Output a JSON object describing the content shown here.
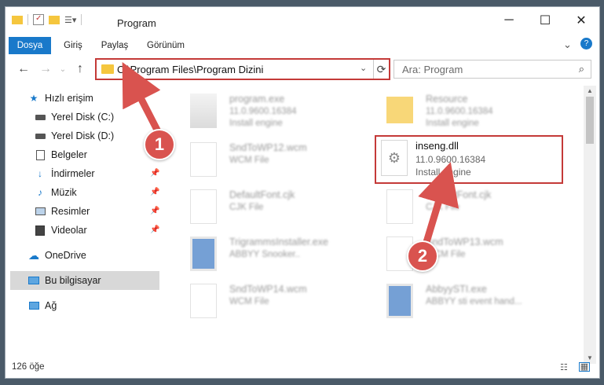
{
  "window": {
    "title": "Program",
    "controls": [
      "minimize",
      "maximize",
      "close"
    ]
  },
  "ribbon": {
    "tabs": [
      {
        "label": "Dosya",
        "active": true
      },
      {
        "label": "Giriş",
        "active": false
      },
      {
        "label": "Paylaş",
        "active": false
      },
      {
        "label": "Görünüm",
        "active": false
      }
    ]
  },
  "address": {
    "path": "C:\\Program Files\\Program Dizini"
  },
  "search": {
    "placeholder": "Ara: Program"
  },
  "sidebar": {
    "items": [
      {
        "label": "Hızlı erişim",
        "icon": "star-icon"
      },
      {
        "label": "Yerel Disk (C:)",
        "icon": "drive-icon"
      },
      {
        "label": "Yerel Disk (D:)",
        "icon": "drive-icon"
      },
      {
        "label": "Belgeler",
        "icon": "documents-icon"
      },
      {
        "label": "İndirmeler",
        "icon": "download-icon"
      },
      {
        "label": "Müzik",
        "icon": "music-icon"
      },
      {
        "label": "Resimler",
        "icon": "pictures-icon"
      },
      {
        "label": "Videolar",
        "icon": "video-icon"
      },
      {
        "label": "OneDrive",
        "icon": "cloud-icon"
      },
      {
        "label": "Bu bilgisayar",
        "icon": "computer-icon",
        "selected": true
      },
      {
        "label": "Ağ",
        "icon": "network-icon"
      }
    ]
  },
  "files": [
    {
      "name": "program.exe",
      "line2": "11.0.9600.16384",
      "line3": "Install engine"
    },
    {
      "name": "Resource",
      "line2": "11.0.9600.16384",
      "line3": "Install engine"
    },
    {
      "name": "SndToWP12.wcm",
      "line2": "WCM File",
      "line3": ""
    },
    {
      "name": "DefaultFont.cjk",
      "line2": "CJK File",
      "line3": ""
    },
    {
      "name": "DefaultFont.cjk",
      "line2": "CJK File",
      "line3": ""
    },
    {
      "name": "TrigrammsInstaller.exe",
      "line2": "ABBYY Snooker..",
      "line3": ""
    },
    {
      "name": "SndToWP13.wcm",
      "line2": "WCM File",
      "line3": ""
    },
    {
      "name": "SndToWP14.wcm",
      "line2": "WCM File",
      "line3": ""
    },
    {
      "name": "AbbyySTI.exe",
      "line2": "ABBYY sti event hand...",
      "line3": ""
    }
  ],
  "highlighted_file": {
    "name": "inseng.dll",
    "line2": "11.0.9600.16384",
    "line3": "Install engine"
  },
  "annotations": [
    "1",
    "2"
  ],
  "status": {
    "count": "126 öğe"
  },
  "colors": {
    "accent": "#1979ca",
    "annotation": "#d9534f",
    "folder": "#f5c63e"
  }
}
